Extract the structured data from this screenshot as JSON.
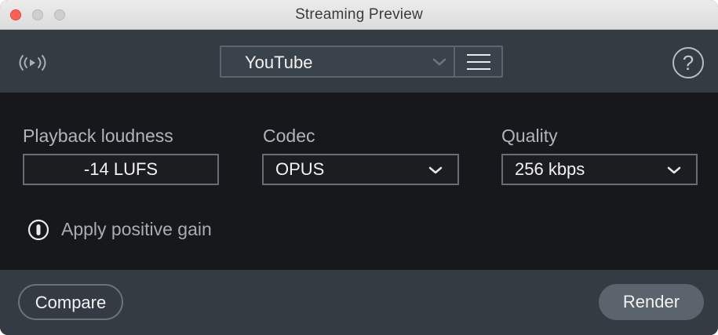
{
  "window": {
    "title": "Streaming Preview"
  },
  "toolbar": {
    "preset": "YouTube",
    "icons": {
      "broadcast": "broadcast-icon",
      "dropdown": "chevron-down-icon",
      "menu": "hamburger-menu-icon",
      "help": "help-icon"
    },
    "help_glyph": "?"
  },
  "settings": {
    "playback_loudness": {
      "label": "Playback loudness",
      "value": "-14  LUFS"
    },
    "codec": {
      "label": "Codec",
      "value": "OPUS"
    },
    "quality": {
      "label": "Quality",
      "value": "256 kbps"
    },
    "positive_gain": {
      "label": "Apply positive gain",
      "enabled": false
    }
  },
  "footer": {
    "compare_label": "Compare",
    "render_label": "Render"
  },
  "colors": {
    "toolbar_bg": "#343b43",
    "panel_bg": "#16181b",
    "text_primary": "#f2f2f2",
    "text_secondary": "#b0b5bb",
    "close_button": "#fe5f57"
  }
}
